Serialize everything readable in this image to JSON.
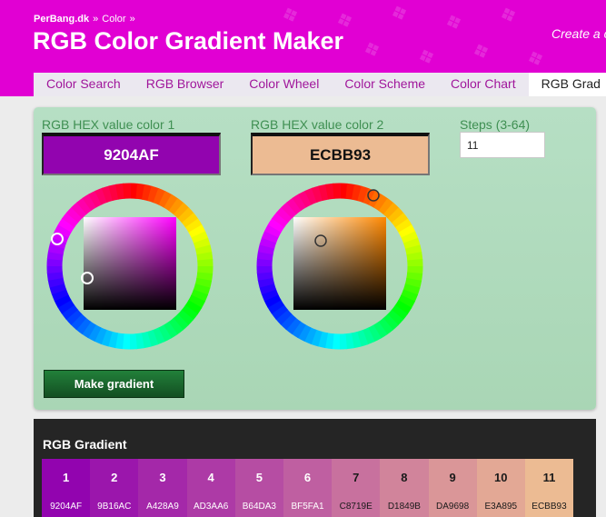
{
  "header": {
    "breadcrumb": [
      "PerBang.dk",
      "Color"
    ],
    "breadcrumb_separator": "»",
    "title": "RGB Color Gradient Maker",
    "tagline": "Create a c",
    "background_color": "#e100d3"
  },
  "tabs": [
    {
      "label": "Color Search",
      "active": false
    },
    {
      "label": "RGB Browser",
      "active": false
    },
    {
      "label": "Color Wheel",
      "active": false
    },
    {
      "label": "Color Scheme",
      "active": false
    },
    {
      "label": "Color Chart",
      "active": false
    },
    {
      "label": "RGB Grad",
      "active": true
    }
  ],
  "form": {
    "color1": {
      "label": "RGB HEX value color 1",
      "value": "9204AF",
      "color": "#9204af"
    },
    "color2": {
      "label": "RGB HEX value color 2",
      "value": "ECBB93",
      "color": "#ecbb93"
    },
    "steps": {
      "label": "Steps (3-64)",
      "value": "11"
    },
    "picker1": {
      "hue_color": "#ff00ff"
    },
    "picker2": {
      "hue_color": "#ff8800"
    },
    "make_button_label": "Make gradient"
  },
  "result": {
    "title": "RGB Gradient",
    "swatches": [
      {
        "number": "1",
        "hex": "9204AF",
        "color": "#9204af"
      },
      {
        "number": "2",
        "hex": "9B16AC",
        "color": "#9b16ac"
      },
      {
        "number": "3",
        "hex": "A428A9",
        "color": "#a428a9"
      },
      {
        "number": "4",
        "hex": "AD3AA6",
        "color": "#ad3aa6"
      },
      {
        "number": "5",
        "hex": "B64DA3",
        "color": "#b64da3"
      },
      {
        "number": "6",
        "hex": "BF5FA1",
        "color": "#bf5fa1"
      },
      {
        "number": "7",
        "hex": "C8719E",
        "color": "#c8719e"
      },
      {
        "number": "8",
        "hex": "D1849B",
        "color": "#d1849b"
      },
      {
        "number": "9",
        "hex": "DA9698",
        "color": "#da9698"
      },
      {
        "number": "10",
        "hex": "E3A895",
        "color": "#e3a895"
      },
      {
        "number": "11",
        "hex": "ECBB93",
        "color": "#ecbb93"
      }
    ]
  }
}
